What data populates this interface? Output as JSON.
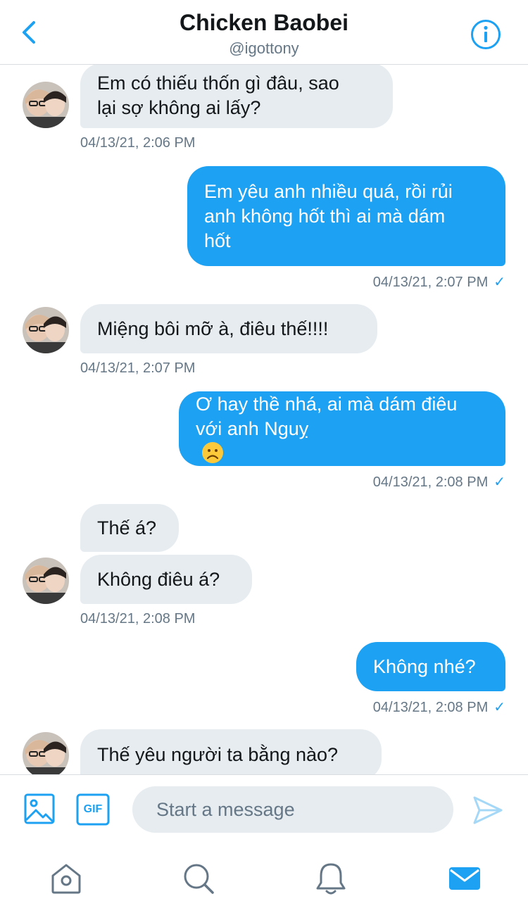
{
  "header": {
    "title": "Chicken Baobei",
    "handle": "@igottony"
  },
  "messages": [
    {
      "direction": "in",
      "text": "Em có thiếu thốn gì đâu, sao lại sợ không ai lấy?",
      "lines": [
        "Em có thiếu thốn gì đâu, sao",
        "lại sợ không ai lấy?"
      ],
      "timestamp": "04/13/21, 2:06 PM"
    },
    {
      "direction": "out",
      "text": "Em yêu anh nhiều quá, rồi rủi anh không hốt thì ai mà dám hốt",
      "lines": [
        "Em yêu anh nhiều quá, rồi rủi",
        "anh không hốt thì ai mà dám",
        "hốt"
      ],
      "timestamp": "04/13/21, 2:07 PM",
      "read_icon": "check-icon"
    },
    {
      "direction": "in",
      "text": "Miệng bôi mỡ à, điêu thế!!!!",
      "lines": [
        "Miệng bôi mỡ à, điêu thế!!!!"
      ],
      "timestamp": "04/13/21, 2:07 PM"
    },
    {
      "direction": "out",
      "text": "Ơ hay thề nhá, ai mà dám điêu với anh Nguỵ",
      "lines": [
        "Ơ hay thề nhá, ai mà dám điêu",
        "với anh Nguỵ"
      ],
      "emoji": "frowning-face-emoji",
      "timestamp": "04/13/21, 2:08 PM",
      "read_icon": "check-icon"
    },
    {
      "direction": "in",
      "text": "Thế á?",
      "lines": [
        "Thế á?"
      ]
    },
    {
      "direction": "in",
      "text": "Không điêu á?",
      "lines": [
        "Không điêu á?"
      ],
      "timestamp": "04/13/21, 2:08 PM"
    },
    {
      "direction": "out",
      "text": "Không nhé?",
      "lines": [
        "Không nhé?"
      ],
      "timestamp": "04/13/21, 2:08 PM",
      "read_icon": "check-icon"
    },
    {
      "direction": "in",
      "text": "Thế yêu người ta bằng nào?",
      "lines": [
        "Thế yêu người ta bằng nào?"
      ]
    }
  ],
  "composer": {
    "placeholder": "Start a message",
    "gif_label": "GIF"
  },
  "tabs": [
    "home-icon",
    "search-icon",
    "notifications-icon",
    "messages-icon"
  ],
  "colors": {
    "accent": "#1da1f2",
    "bubble_in": "#e6ecf0",
    "text_secondary": "#657786",
    "send_disabled": "#a5d8f7"
  }
}
